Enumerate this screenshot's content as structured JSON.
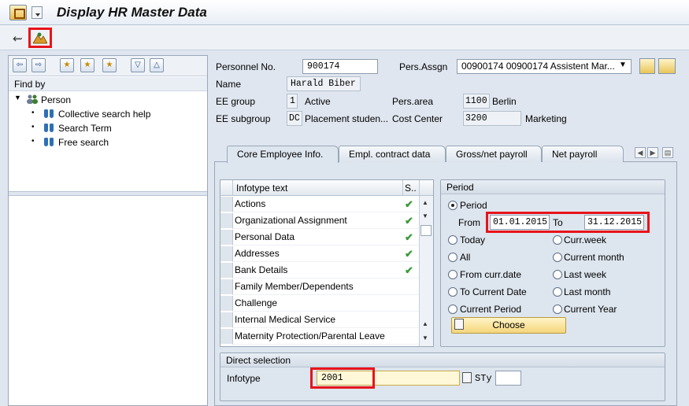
{
  "window": {
    "title": "Display HR Master Data"
  },
  "toolbar": {
    "back_icon": "back-arrow-icon",
    "other_icon": "mountain-person-icon"
  },
  "left_panel": {
    "findby_label": "Find by",
    "tree": {
      "root": "Person",
      "children": [
        "Collective search help",
        "Search Term",
        "Free search"
      ]
    }
  },
  "header": {
    "personnel_no_label": "Personnel No.",
    "personnel_no_value": "900174",
    "pers_assgn_label": "Pers.Assgn",
    "pers_assgn_value": "00900174 00900174 Assistent Mar...",
    "name_label": "Name",
    "name_value": "Harald Biber",
    "ee_group_label": "EE group",
    "ee_group_code": "1",
    "ee_group_text": "Active",
    "pers_area_label": "Pers.area",
    "pers_area_code": "1100",
    "pers_area_text": "Berlin",
    "ee_subgroup_label": "EE subgroup",
    "ee_subgroup_code": "DC",
    "ee_subgroup_text": "Placement studen...",
    "cost_center_label": "Cost Center",
    "cost_center_code": "3200",
    "cost_center_text": "Marketing"
  },
  "tabs": [
    {
      "label": "Core Employee Info.",
      "active": true
    },
    {
      "label": "Empl. contract data",
      "active": false
    },
    {
      "label": "Gross/net payroll",
      "active": false
    },
    {
      "label": "Net payroll",
      "active": false
    }
  ],
  "infotype_table": {
    "col_text": "Infotype text",
    "col_status": "S..",
    "rows": [
      {
        "text": "Actions",
        "status": "✔"
      },
      {
        "text": "Organizational Assignment",
        "status": "✔"
      },
      {
        "text": "Personal Data",
        "status": "✔"
      },
      {
        "text": "Addresses",
        "status": "✔"
      },
      {
        "text": "Bank Details",
        "status": "✔"
      },
      {
        "text": "Family Member/Dependents",
        "status": ""
      },
      {
        "text": "Challenge",
        "status": ""
      },
      {
        "text": "Internal Medical Service",
        "status": ""
      },
      {
        "text": "Maternity Protection/Parental Leave",
        "status": ""
      }
    ]
  },
  "period": {
    "title": "Period",
    "period_label": "Period",
    "from_label": "From",
    "from_value": "01.01.2015",
    "to_label": "To",
    "to_value": "31.12.2015",
    "options_left": [
      "Today",
      "All",
      "From curr.date",
      "To Current Date",
      "Current Period"
    ],
    "options_right": [
      "Curr.week",
      "Current month",
      "Last week",
      "Last month",
      "Current Year"
    ],
    "choose_label": "Choose"
  },
  "direct_selection": {
    "title": "Direct selection",
    "infotype_label": "Infotype",
    "infotype_value": "2001",
    "sty_label": "STy",
    "sty_value": ""
  },
  "colors": {
    "highlight": "#e8131b",
    "check": "#3e9a3a",
    "choose_bg": "#f4d57b"
  }
}
